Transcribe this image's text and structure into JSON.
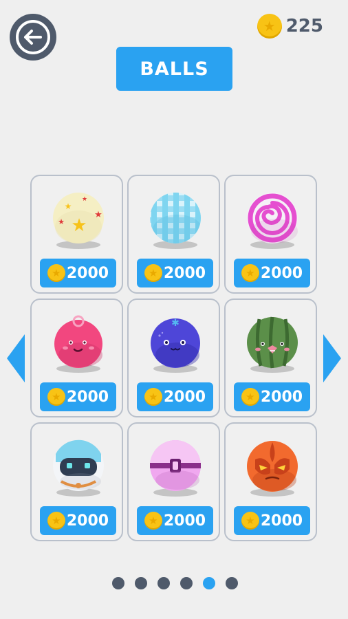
{
  "header": {
    "back_icon": "arrow-left-circle-icon",
    "coin_balance": "225",
    "title": "BALLS"
  },
  "shop": {
    "items": [
      {
        "name": "star-ball",
        "price": "2000"
      },
      {
        "name": "checkered-ball",
        "price": "2000"
      },
      {
        "name": "swirl-ball",
        "price": "2000"
      },
      {
        "name": "pink-face-ball",
        "price": "2000"
      },
      {
        "name": "blue-face-ball",
        "price": "2000"
      },
      {
        "name": "watermelon-ball",
        "price": "2000"
      },
      {
        "name": "robot-ball",
        "price": "2000"
      },
      {
        "name": "capsule-ball",
        "price": "2000"
      },
      {
        "name": "fire-mask-ball",
        "price": "2000"
      }
    ]
  },
  "pagination": {
    "total_pages": 6,
    "active_page": 5
  },
  "colors": {
    "accent": "#2aa2f1",
    "dark": "#4f5a6b",
    "coin": "#f8c315",
    "background": "#efefef"
  }
}
